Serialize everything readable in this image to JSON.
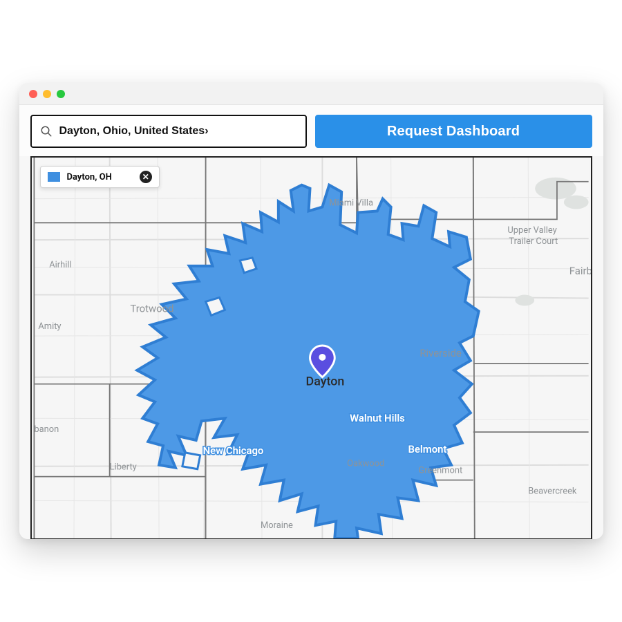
{
  "search": {
    "value": "Dayton, Ohio, United States›"
  },
  "buttons": {
    "request_label": "Request Dashboard"
  },
  "legend": {
    "label": "Dayton, OH"
  },
  "map": {
    "center_label": "Dayton",
    "places": {
      "airhill": "Airhill",
      "amity": "Amity",
      "banon": "banon",
      "liberty": "Liberty",
      "trotwood": "Trotwood",
      "miami_villa": "Miami Villa",
      "upper_valley": "Upper Valley\nTrailer Court",
      "fairbo": "Fairbo",
      "riverside": "Riverside",
      "oakwood": "Oakwood",
      "moraine": "Moraine",
      "beavercreek": "Beavercreek",
      "greenmont": "Greenmont",
      "walnut_hills": "Walnut Hills",
      "belmont": "Belmont",
      "new_chicago": "New Chicago"
    },
    "pin_color": "#5a4ee0",
    "region_color": "#4d99e6"
  }
}
